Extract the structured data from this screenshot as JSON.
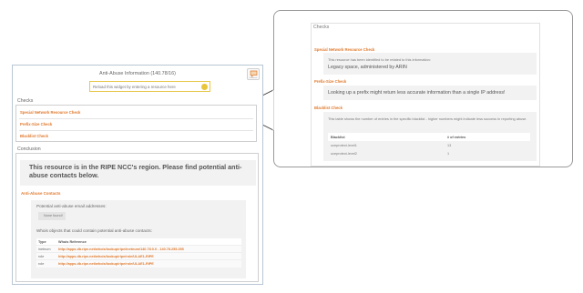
{
  "widget": {
    "title": "Anti-Abuse Information (140.78/16)",
    "feedback_label": "Feedback",
    "search_placeholder": "Reload this widget by entering a resource here",
    "checks_title": "Checks",
    "checks": [
      {
        "label": "Special Network Resource Check"
      },
      {
        "label": "Prefix-Size Check"
      },
      {
        "label": "Blacklist Check"
      }
    ],
    "conclusion_title": "Conclusion",
    "conclusion_message": "This resource is in the RIPE NCC's region. Please find potential anti-abuse contacts below.",
    "contacts_title": "Anti-Abuse Contacts",
    "email_label": "Potential anti-abuse email addresses:",
    "none_found": "None found!",
    "whois_label": "Whois objects that could contain potential anti-abuse contacts:",
    "table_headers": {
      "type": "Type",
      "ref": "Whois Reference"
    },
    "table_rows": [
      {
        "type": "inetnum",
        "ref": "http://apps.db.ripe.net/whois/lookup/ripe/inetnum/140.78.0.0 - 140.78.255.255"
      },
      {
        "type": "role",
        "ref": "http://apps.db.ripe.net/whois/lookup/ripe/role/ULAE1-RIPE"
      },
      {
        "type": "role",
        "ref": "http://apps.db.ripe.net/whois/lookup/ripe/role/ULAE1-RIPE"
      }
    ]
  },
  "callout": {
    "title": "Checks",
    "special_label": "Special Network Resource Check",
    "special_small": "This resource has been identified to be related to this information:",
    "special_big": "Legacy space, administered by ARIN",
    "prefix_label": "Prefix-Size Check",
    "prefix_big": "Looking up a prefix might return less accurate information than a single IP address!",
    "blacklist_label": "Blacklist Check",
    "blacklist_small": "This table shows the number of entries in the specific blacklist - higher numbers might indicate less success in reporting abuse.",
    "table_headers": {
      "list": "Blacklist",
      "count": "# of entries"
    },
    "table_rows": [
      {
        "list": "uceprotect-level1",
        "count": "13"
      },
      {
        "list": "uceprotect-level2",
        "count": "1"
      }
    ]
  },
  "colors": {
    "accent": "#e07a2e",
    "search_border": "#e6c84a",
    "widget_border": "#b8c7d4"
  },
  "icons": {
    "feedback": "speech-bubble-icon",
    "search": "search-icon"
  }
}
